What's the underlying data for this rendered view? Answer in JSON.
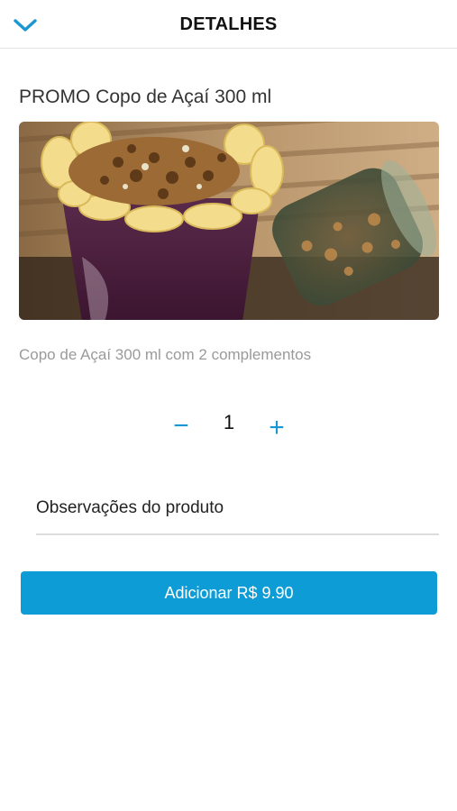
{
  "header": {
    "title": "DETALHES",
    "back_icon": "chevron-down-icon"
  },
  "product": {
    "name": "PROMO Copo de Açaí 300 ml",
    "description": "Copo de Açaí 300 ml com 2 complementos",
    "image_subject": "acai-cup-photo"
  },
  "quantity": {
    "minus_label": "−",
    "value": "1",
    "plus_label": "+"
  },
  "notes": {
    "label": "Observações do produto"
  },
  "add_button": {
    "label": "Adicionar R$ 9.90"
  },
  "colors": {
    "accent": "#0e9cd6",
    "title_text": "#111111",
    "muted_text": "#9a9a9a"
  }
}
